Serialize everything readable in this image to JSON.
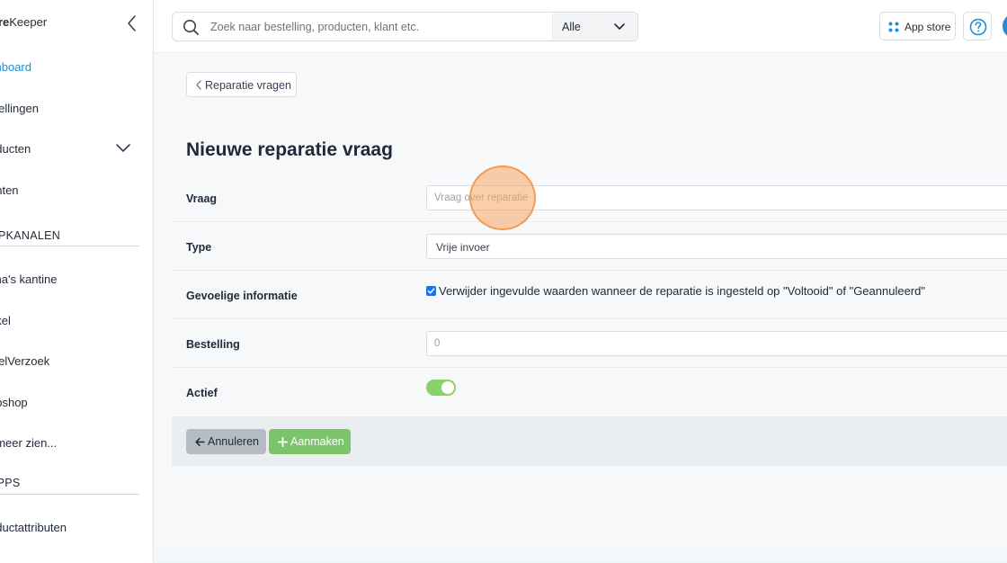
{
  "sidebar": {
    "brand_prefix": "ore",
    "brand_suffix": "Keeper",
    "items": [
      {
        "label": "shboard",
        "active": true
      },
      {
        "label": "stellingen"
      },
      {
        "label": "oducten"
      },
      {
        "label": "anten"
      }
    ],
    "section_sales_channels": "OPKANALEN",
    "channels": [
      {
        "label": "cha's kantine"
      },
      {
        "label": "nkel"
      },
      {
        "label": "stelVerzoek"
      },
      {
        "label": "ebshop"
      },
      {
        "label": "t meer zien..."
      }
    ],
    "section_apps": "APPS",
    "apps": [
      {
        "label": "oductattributen"
      }
    ]
  },
  "topbar": {
    "search_placeholder": "Zoek naar bestelling, producten, klant etc.",
    "search_value": "",
    "scope_selected": "Alle",
    "appstore_label": "App store",
    "help_icon": "question-circle-icon"
  },
  "page": {
    "back_label": "Reparatie vragen",
    "title": "Nieuwe reparatie vraag"
  },
  "form": {
    "question_label": "Vraag",
    "question_placeholder": "Vraag over reparatie",
    "question_value": "",
    "type_label": "Type",
    "type_value": "Vrije invoer",
    "sensitive_label": "Gevoelige informatie",
    "sensitive_checked": true,
    "sensitive_text": "Verwijder ingevulde waarden wanneer de reparatie is ingesteld op \"Voltooid\" of \"Geannuleerd\"",
    "order_label": "Bestelling",
    "order_placeholder": "0",
    "order_value": "",
    "active_label": "Actief",
    "active_on": true
  },
  "actions": {
    "cancel_label": "Annuleren",
    "create_label": "Aanmaken"
  },
  "colors": {
    "accent": "#1d8fd6",
    "toggle_on": "#8bd16a",
    "create_button": "#7cc46a",
    "cancel_button": "#b6bcc3",
    "checkbox": "#1a73e8"
  }
}
